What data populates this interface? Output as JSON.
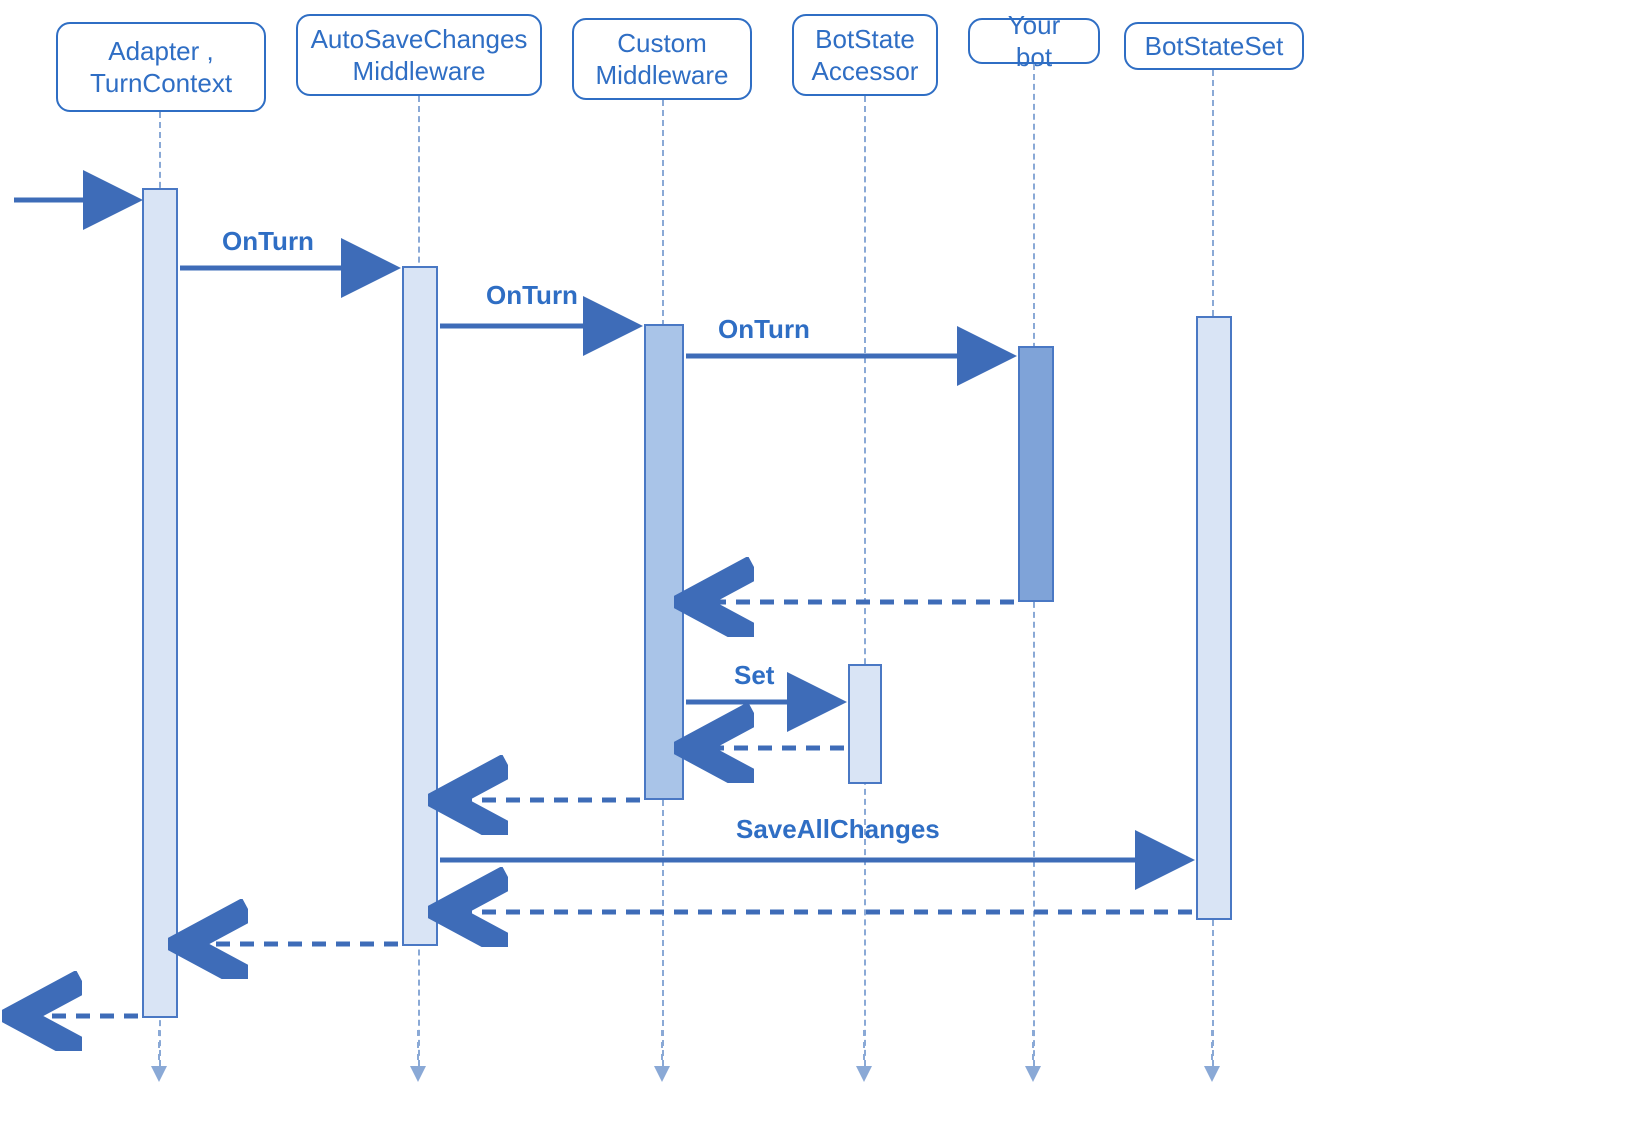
{
  "participants": {
    "adapter": {
      "label": "Adapter , TurnContext"
    },
    "autosave": {
      "label": "AutoSaveChanges Middleware"
    },
    "custom": {
      "label": "Custom Middleware"
    },
    "accessor": {
      "label": "BotState Accessor"
    },
    "yourbot": {
      "label": "Your bot"
    },
    "stateset": {
      "label": "BotStateSet"
    }
  },
  "messages": {
    "onturn1": "OnTurn",
    "onturn2": "OnTurn",
    "onturn3": "OnTurn",
    "set": "Set",
    "saveall": "SaveAllChanges"
  }
}
